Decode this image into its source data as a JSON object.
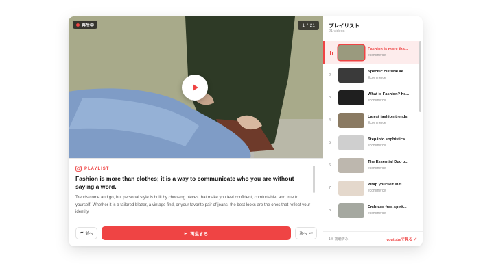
{
  "player": {
    "live_badge": "再生中",
    "counter_current": "1",
    "counter_sep": "/",
    "counter_total": "21",
    "progress_fraction": 0.0
  },
  "now_playing": {
    "tag": "PLAYLIST",
    "title": "Fashion is more than clothes; it is a way to communicate who you are without saying a word.",
    "description": "Trends come and go, but personal style is built by choosing pieces that make you feel confident, comfortable, and true to yourself. Whether it is a tailored blazer, a vintage find, or your favorite pair of jeans, the best looks are the ones that reflect your identity."
  },
  "controls": {
    "prev_label": "前へ",
    "play_label": "再生する",
    "next_label": "次へ"
  },
  "playlist": {
    "title": "プレイリスト",
    "count_label": "21 videos",
    "items": [
      {
        "title": "Fashion is more tha...",
        "channel": "ecommerce",
        "index": "1",
        "active": true,
        "thumb": "#9a9a7e"
      },
      {
        "title": "Specific cultural ae...",
        "channel": "Ecommerce",
        "index": "2",
        "active": false,
        "thumb": "#3a3a3a"
      },
      {
        "title": "What is Fashion? he...",
        "channel": "ecommerce",
        "index": "3",
        "active": false,
        "thumb": "#1f1f1f"
      },
      {
        "title": "Latest fashion trends",
        "channel": "Ecommerce",
        "index": "4",
        "active": false,
        "thumb": "#8a7a62"
      },
      {
        "title": "Step into sophistica...",
        "channel": "ecommerce",
        "index": "5",
        "active": false,
        "thumb": "#cfcfcf"
      },
      {
        "title": "The Essential Duo o...",
        "channel": "ecommerce",
        "index": "6",
        "active": false,
        "thumb": "#bdb7ae"
      },
      {
        "title": "Wrap yourself in ti...",
        "channel": "ecommerce",
        "index": "7",
        "active": false,
        "thumb": "#e4d8cc"
      },
      {
        "title": "Embrace free-spirit...",
        "channel": "ecommerce",
        "index": "8",
        "active": false,
        "thumb": "#a5a8a0"
      }
    ],
    "footer_left": "1% 視聴済み",
    "footer_right": "youtubeで見る"
  },
  "colors": {
    "accent": "#ef4444",
    "video_bg": "#a9ab8c"
  }
}
